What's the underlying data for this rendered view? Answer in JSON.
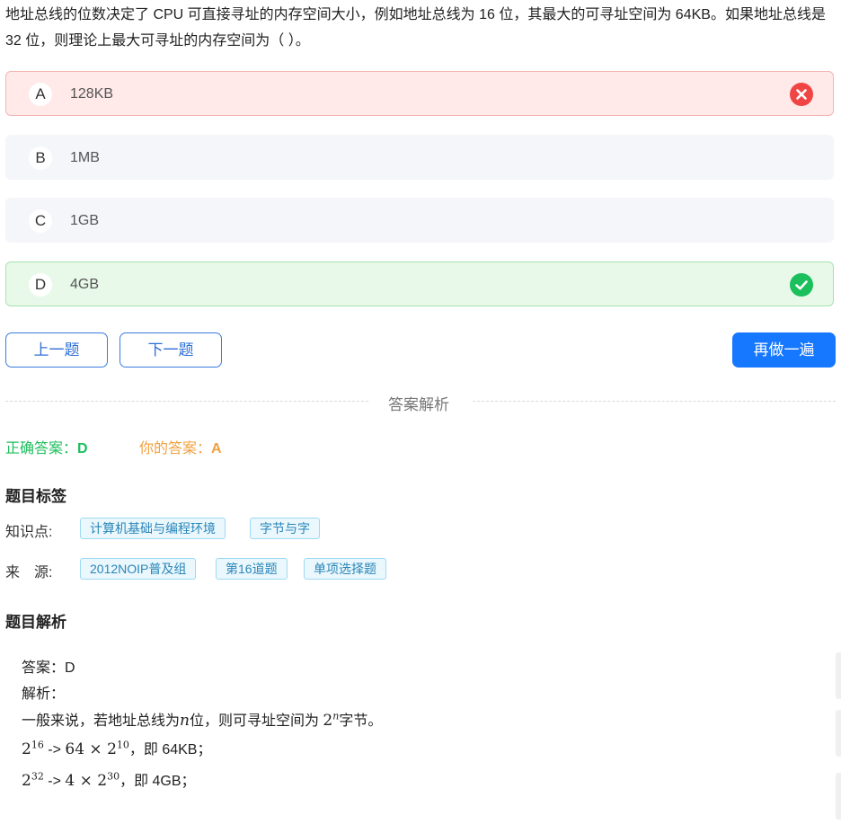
{
  "question": {
    "text": "地址总线的位数决定了 CPU 可直接寻址的内存空间大小，例如地址总线为 16 位，其最大的可寻址空间为 64KB。如果地址总线是 32 位，则理论上最大可寻址的内存空间为（   ）。"
  },
  "options": [
    {
      "letter": "A",
      "text": "128KB",
      "status": "wrong",
      "icon": "close-circle-icon"
    },
    {
      "letter": "B",
      "text": "1MB",
      "status": "none"
    },
    {
      "letter": "C",
      "text": "1GB",
      "status": "none"
    },
    {
      "letter": "D",
      "text": "4GB",
      "status": "correct",
      "icon": "check-circle-icon"
    }
  ],
  "buttons": {
    "prev": "上一题",
    "next": "下一题",
    "redo": "再做一遍"
  },
  "divider_label": "答案解析",
  "answers": {
    "correct_label": "正确答案：",
    "correct_value": "D",
    "yours_label": "你的答案：",
    "yours_value": "A"
  },
  "tags_section": {
    "title": "题目标签",
    "knowledge_label": "知识点:",
    "knowledge_tags": [
      "计算机基础与编程环境",
      "字节与字"
    ],
    "source_label": "来　源:",
    "source_tags": [
      "2012NOIP普及组",
      "第16道题",
      "单项选择题"
    ]
  },
  "analysis": {
    "title": "题目解析",
    "answer_line": "答案：D",
    "explain_label": "解析：",
    "line1_pre": "一般来说，若地址总线为",
    "line1_var": "n",
    "line1_mid": "位，则可寻址空间为 ",
    "line1_base": "2",
    "line1_exp": "n",
    "line1_post": "字节。",
    "line2": {
      "base": "2",
      "exp": "16",
      "arrow": " -> ",
      "mult": "64 × 2",
      "mexp": "10",
      "tail": "，即 64KB；"
    },
    "line3": {
      "base": "2",
      "exp": "32",
      "arrow": " -> ",
      "mult": "4 × 2",
      "mexp": "30",
      "tail": "，即 4GB；"
    }
  },
  "colors": {
    "primary": "#1677ff",
    "wrong": "#f04545",
    "correct": "#1bbf5b",
    "your_answer": "#f0a040"
  }
}
